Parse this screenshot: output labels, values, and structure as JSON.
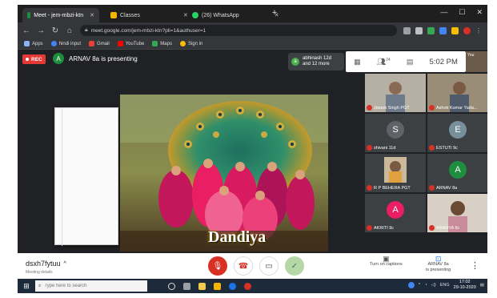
{
  "browser": {
    "tabs": [
      {
        "title": "Meet - jem-mbzi-ktn",
        "color": "#1e8e3e",
        "active": true
      },
      {
        "title": "Classes",
        "color": "#f4b400",
        "active": false
      },
      {
        "title": "(26) WhatsApp",
        "color": "#25d366",
        "active": false
      }
    ],
    "new_tab": "+",
    "url": "meet.google.com/jem-mbzi-ktn?pli=1&authuser=1",
    "bookmarks": [
      {
        "label": "Apps",
        "color": "#8ab4f8"
      },
      {
        "label": "hindi input",
        "color": "#4285f4"
      },
      {
        "label": "Gmail",
        "color": "#ea4335"
      },
      {
        "label": "YouTube",
        "color": "#ff0000"
      },
      {
        "label": "Maps",
        "color": "#34a853"
      },
      {
        "label": "Sign in",
        "color": "#fbbc04"
      }
    ]
  },
  "meet": {
    "rec_label": "REC",
    "presenter_initial": "A",
    "presenter_text": "ARNAV 8a is presenting",
    "joined_initial": "a",
    "joined_line1": "abhinash 12d",
    "joined_line2": "and 12 more",
    "participant_count": "24",
    "time": "5:02 PM",
    "self_label": "You",
    "slide_caption": "Dandiya",
    "participants": [
      {
        "name": "Jasam Singh PGT",
        "initial": "",
        "color": ""
      },
      {
        "name": "Ashok Kumar Yada...",
        "initial": "",
        "color": ""
      },
      {
        "name": "shivani 11d",
        "initial": "S",
        "color": "#5f6368"
      },
      {
        "name": "ESTUTI 9c",
        "initial": "E",
        "color": "#78909c"
      },
      {
        "name": "R P BEHERA PGT",
        "initial": "",
        "color": ""
      },
      {
        "name": "ARNAV 8a",
        "initial": "A",
        "color": "#1e8e3e"
      },
      {
        "name": "AKRITI 9c",
        "initial": "A",
        "color": "#e91e63"
      },
      {
        "name": "ANANYA 9c",
        "initial": "",
        "color": ""
      }
    ]
  },
  "bottom": {
    "meeting_code": "dsxh7fytuu",
    "meeting_sub": "Meeting details",
    "captions_label": "Turn on captions",
    "present_line1": "ARNAV 8a",
    "present_line2": "is presenting"
  },
  "taskbar": {
    "search_placeholder": "Type here to search",
    "lang": "ENG",
    "time": "17:02",
    "date": "29-10-2020"
  }
}
